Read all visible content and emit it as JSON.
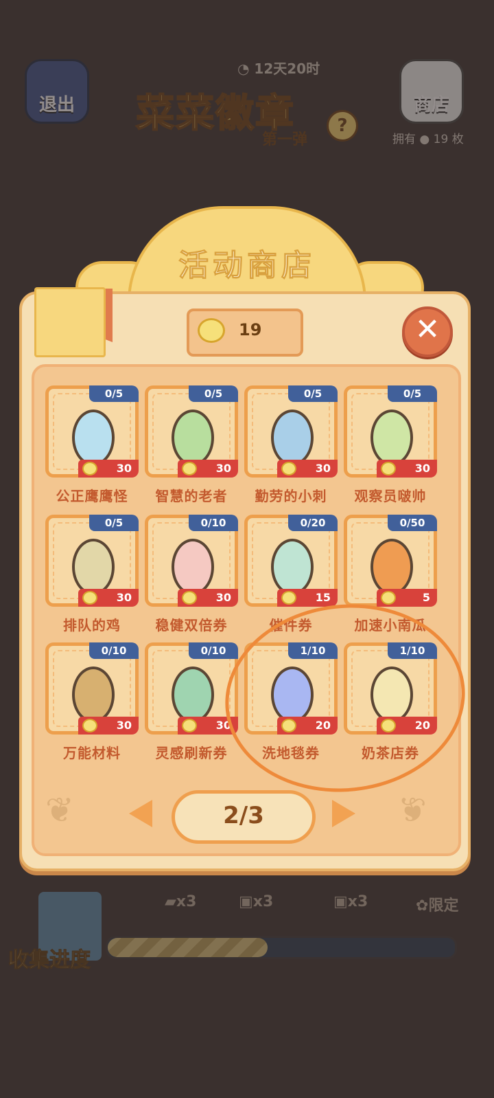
{
  "top_bar": {
    "exit_label": "退出",
    "shop_label": "商店",
    "timer": "12天20时",
    "event_title": "菜菜徽章",
    "event_subtitle": "第一弹",
    "help_symbol": "?",
    "owned_prefix": "拥有",
    "owned_count": "19",
    "owned_suffix": "枚"
  },
  "shop": {
    "title": "活动商店",
    "balance": "19",
    "close_symbol": "✕",
    "page": "2/3",
    "items": [
      {
        "name": "公正鹰鹰怪",
        "stock": "0/5",
        "price": "30",
        "color": "#b9e0ef"
      },
      {
        "name": "智慧的老者",
        "stock": "0/5",
        "price": "30",
        "color": "#b8de9e"
      },
      {
        "name": "勤劳的小刺",
        "stock": "0/5",
        "price": "30",
        "color": "#a9cfe8"
      },
      {
        "name": "观察员啵帅",
        "stock": "0/5",
        "price": "30",
        "color": "#cfe6a5"
      },
      {
        "name": "排队的鸡",
        "stock": "0/5",
        "price": "30",
        "color": "#e2d7a8"
      },
      {
        "name": "稳健双倍券",
        "stock": "0/10",
        "price": "30",
        "color": "#f5c9c2"
      },
      {
        "name": "催件券",
        "stock": "0/20",
        "price": "15",
        "color": "#bfe4d3"
      },
      {
        "name": "加速小南瓜",
        "stock": "0/50",
        "price": "5",
        "color": "#ef9c52"
      },
      {
        "name": "万能材料",
        "stock": "0/10",
        "price": "30",
        "color": "#d7b070"
      },
      {
        "name": "灵感刷新券",
        "stock": "0/10",
        "price": "30",
        "color": "#9fd4b0"
      },
      {
        "name": "洗地毯券",
        "stock": "1/10",
        "price": "20",
        "color": "#a9b7f2"
      },
      {
        "name": "奶茶店券",
        "stock": "1/10",
        "price": "20",
        "color": "#f4e7b2"
      }
    ]
  },
  "progress": {
    "label": "收集进度",
    "fill_fraction": 0.46,
    "rewards": [
      "x3",
      "x3",
      "x3",
      "限定"
    ]
  }
}
